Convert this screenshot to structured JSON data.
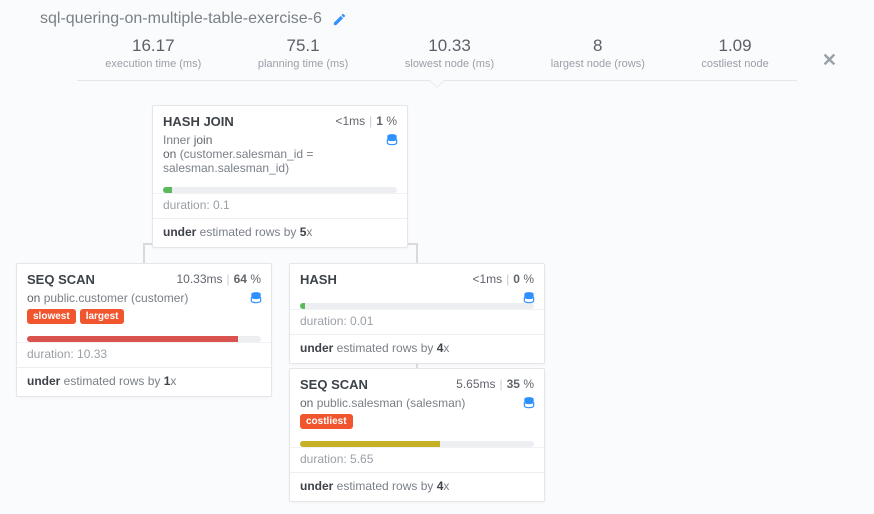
{
  "title": "sql-quering-on-multiple-table-exercise-6",
  "stats": {
    "exec_time": {
      "value": "16.17",
      "label": "execution time (ms)"
    },
    "plan_time": {
      "value": "75.1",
      "label": "planning time (ms)"
    },
    "slowest": {
      "value": "10.33",
      "label": "slowest node (ms)"
    },
    "largest": {
      "value": "8",
      "label": "largest node (rows)"
    },
    "costliest": {
      "value": "1.09",
      "label": "costliest node"
    }
  },
  "nodes": {
    "hash_join": {
      "title": "HASH JOIN",
      "time_html": "<1ms",
      "pct": "1",
      "line1_prefix": "Inner ",
      "line1_gray": "join",
      "line2_gray": "on ",
      "line2": "(customer.salesman_id = salesman.salesman_id)",
      "duration": "0.1",
      "under_factor": "5"
    },
    "seq_customer": {
      "title": "SEQ SCAN",
      "time_html": "10.33ms",
      "pct": "64",
      "on_gray": "on ",
      "on": "public.customer (customer)",
      "tags": [
        "slowest",
        "largest"
      ],
      "duration": "10.33",
      "under_factor": "1"
    },
    "hash": {
      "title": "HASH",
      "time_html": "<1ms",
      "pct": "0",
      "duration": "0.01",
      "under_factor": "4"
    },
    "seq_salesman": {
      "title": "SEQ SCAN",
      "time_html": "5.65ms",
      "pct": "35",
      "on_gray": "on ",
      "on": "public.salesman (salesman)",
      "tags": [
        "costliest"
      ],
      "duration": "5.65",
      "under_factor": "4"
    }
  },
  "labels": {
    "duration_prefix": "duration: ",
    "under_prefix": "under",
    "under_mid": " estimated rows by ",
    "under_suffix": "x"
  }
}
